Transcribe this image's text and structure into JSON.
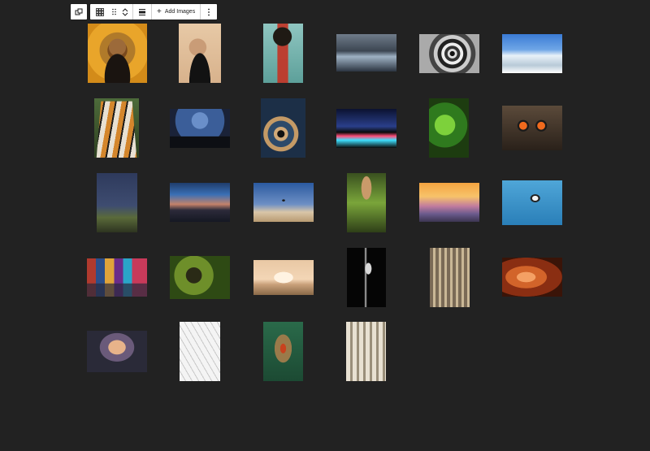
{
  "toolbar": {
    "parent_select_icon": "block-parent-icon",
    "block_type_icon": "gallery-grid-icon",
    "drag_icon": "drag-handle-icon",
    "move_up_icon": "chevron-up-icon",
    "move_down_icon": "chevron-down-icon",
    "align_icon": "align-icon",
    "add_images_label": "Add Images",
    "options_icon": "more-vertical-icon"
  },
  "gallery": {
    "images": [
      {
        "name": "masked-portrait-yellow",
        "alt": ""
      },
      {
        "name": "woman-with-mask-portrait",
        "alt": ""
      },
      {
        "name": "afro-woman-teal",
        "alt": ""
      },
      {
        "name": "stormy-coast",
        "alt": ""
      },
      {
        "name": "spiral-staircase",
        "alt": ""
      },
      {
        "name": "snowy-mountains",
        "alt": ""
      },
      {
        "name": "tiger",
        "alt": ""
      },
      {
        "name": "star-trails",
        "alt": ""
      },
      {
        "name": "spiral-stairs-top",
        "alt": ""
      },
      {
        "name": "city-night-skyline",
        "alt": ""
      },
      {
        "name": "green-chameleon",
        "alt": ""
      },
      {
        "name": "owl",
        "alt": ""
      },
      {
        "name": "night-sky-mountain",
        "alt": ""
      },
      {
        "name": "sunset-mountains",
        "alt": ""
      },
      {
        "name": "lone-tree-desert",
        "alt": ""
      },
      {
        "name": "mushroom-moss",
        "alt": ""
      },
      {
        "name": "pastel-sunset-hills",
        "alt": ""
      },
      {
        "name": "bird-on-water",
        "alt": ""
      },
      {
        "name": "times-square",
        "alt": ""
      },
      {
        "name": "fly-macro",
        "alt": ""
      },
      {
        "name": "taj-mahal",
        "alt": ""
      },
      {
        "name": "heron-dark",
        "alt": ""
      },
      {
        "name": "gallery-arcade",
        "alt": ""
      },
      {
        "name": "antelope-canyon",
        "alt": ""
      },
      {
        "name": "tunnel-sunset",
        "alt": ""
      },
      {
        "name": "white-architecture",
        "alt": ""
      },
      {
        "name": "mandrill",
        "alt": ""
      },
      {
        "name": "colonnade",
        "alt": ""
      }
    ]
  }
}
